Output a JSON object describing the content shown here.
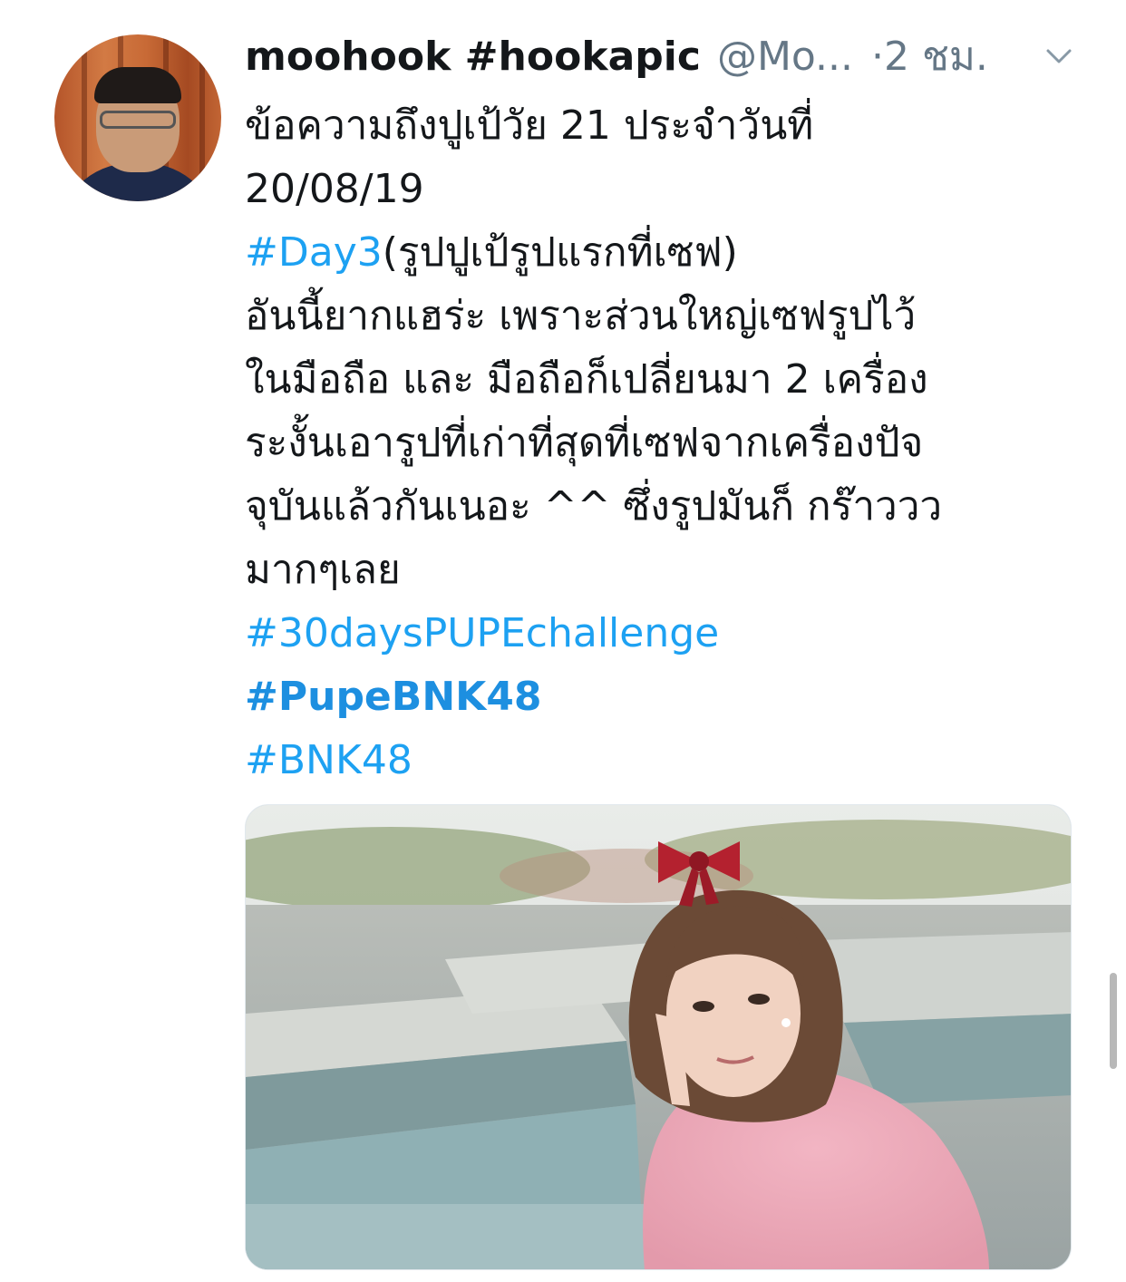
{
  "author": {
    "display_name": "moohook #hookapic",
    "handle": "@Mo...",
    "time": "·2 ชม."
  },
  "tweet": {
    "line1": "ข้อความถึงปูเป้วัย 21 ประจำวันที่",
    "line2": "20/08/19",
    "line3_hashtag": "#Day3",
    "line3_text": "(รูปปูเป้รูปแรกที่เซฟ)",
    "line4": "อันนี้ยากแฮร่ะ เพราะส่วนใหญ่เซฟรูปไว้",
    "line5": "ในมือถือ และ มือถือก็เปลี่ยนมา 2 เครื่อง",
    "line6": "ระงั้นเอารูปที่เก่าที่สุดที่เซฟจากเครื่องปัจ",
    "line7": "จุบันแล้วกันเนอะ ^^ ซึ่งรูปมันก็ กร๊าววว",
    "line8": "มากๆเลย",
    "hashtags": [
      "#30daysPUPEchallenge",
      "#PupeBNK48",
      "#BNK48"
    ]
  },
  "icons": {
    "menu": "chevron-down-icon"
  },
  "colors": {
    "link": "#1da1f2",
    "text": "#14171a",
    "secondary": "#657786"
  }
}
